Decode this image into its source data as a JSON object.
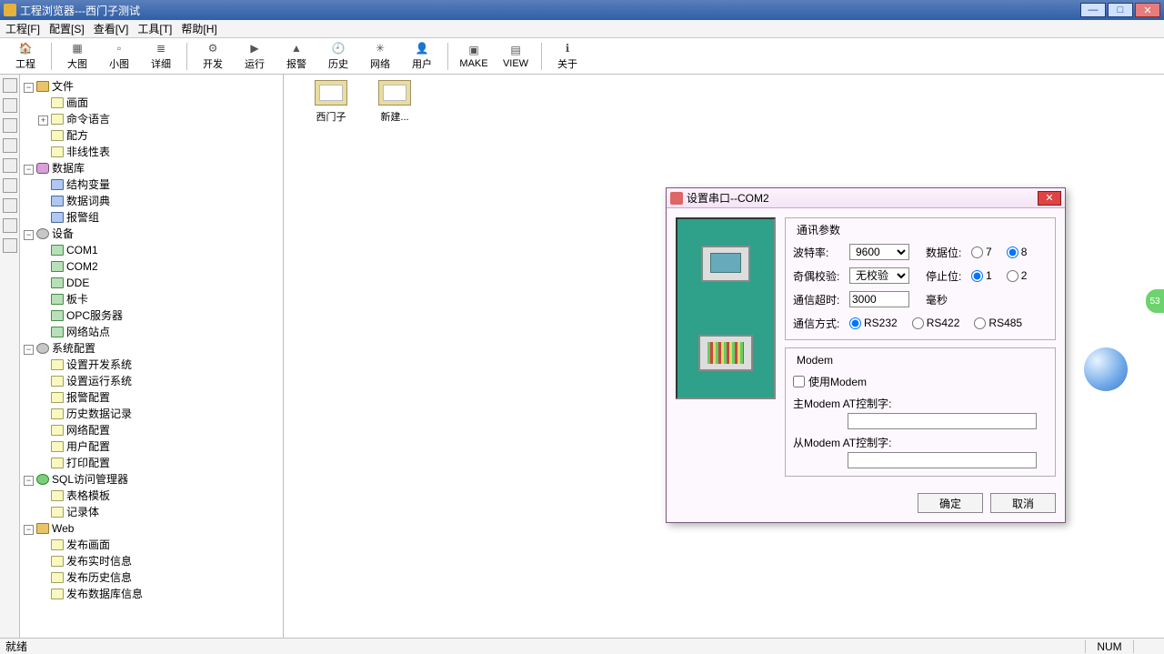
{
  "titlebar": {
    "title": "工程浏览器---西门子测试"
  },
  "menu": {
    "items": [
      "工程[F]",
      "配置[S]",
      "查看[V]",
      "工具[T]",
      "帮助[H]"
    ]
  },
  "toolbar": [
    {
      "label": "工程",
      "icon": "🏠"
    },
    {
      "label": "大图",
      "icon": "▦"
    },
    {
      "label": "小图",
      "icon": "▫"
    },
    {
      "label": "详细",
      "icon": "≣"
    },
    {
      "label": "开发",
      "icon": "⚙"
    },
    {
      "label": "运行",
      "icon": "▶"
    },
    {
      "label": "报警",
      "icon": "▲"
    },
    {
      "label": "历史",
      "icon": "🕘"
    },
    {
      "label": "网络",
      "icon": "✳"
    },
    {
      "label": "用户",
      "icon": "👤"
    },
    {
      "label": "MAKE",
      "icon": "▣"
    },
    {
      "label": "VIEW",
      "icon": "▤"
    },
    {
      "label": "关于",
      "icon": "ℹ"
    }
  ],
  "tree": {
    "file": {
      "label": "文件",
      "children": [
        "画面",
        "命令语言",
        "配方",
        "非线性表"
      ]
    },
    "db": {
      "label": "数据库",
      "children": [
        "结构变量",
        "数据词典",
        "报警组"
      ]
    },
    "device": {
      "label": "设备",
      "children": [
        "COM1",
        "COM2",
        "DDE",
        "板卡",
        "OPC服务器",
        "网络站点"
      ]
    },
    "syscfg": {
      "label": "系统配置",
      "children": [
        "设置开发系统",
        "设置运行系统",
        "报警配置",
        "历史数据记录",
        "网络配置",
        "用户配置",
        "打印配置"
      ]
    },
    "sql": {
      "label": "SQL访问管理器",
      "children": [
        "表格模板",
        "记录体"
      ]
    },
    "web": {
      "label": "Web",
      "children": [
        "发布画面",
        "发布实时信息",
        "发布历史信息",
        "发布数据库信息"
      ]
    }
  },
  "content_icons": [
    {
      "label": "西门子"
    },
    {
      "label": "新建..."
    }
  ],
  "dialog": {
    "title": "设置串口--COM2",
    "comm": {
      "legend": "通讯参数",
      "baud_label": "波特率:",
      "baud_value": "9600",
      "parity_label": "奇偶校验:",
      "parity_value": "无校验",
      "timeout_label": "通信超时:",
      "timeout_value": "3000",
      "timeout_unit": "毫秒",
      "mode_label": "通信方式:",
      "mode_opts": [
        "RS232",
        "RS422",
        "RS485"
      ],
      "mode_sel": 0,
      "databits_label": "数据位:",
      "databits_opts": [
        "7",
        "8"
      ],
      "databits_sel": 1,
      "stopbits_label": "停止位:",
      "stopbits_opts": [
        "1",
        "2"
      ],
      "stopbits_sel": 0
    },
    "modem": {
      "legend": "Modem",
      "use_label": "使用Modem",
      "master_label": "主Modem AT控制字:",
      "slave_label": "从Modem AT控制字:",
      "master_value": "",
      "slave_value": ""
    },
    "ok": "确定",
    "cancel": "取消"
  },
  "status": {
    "ready": "就绪",
    "num": "NUM"
  },
  "desk": {
    "badge": "53"
  }
}
